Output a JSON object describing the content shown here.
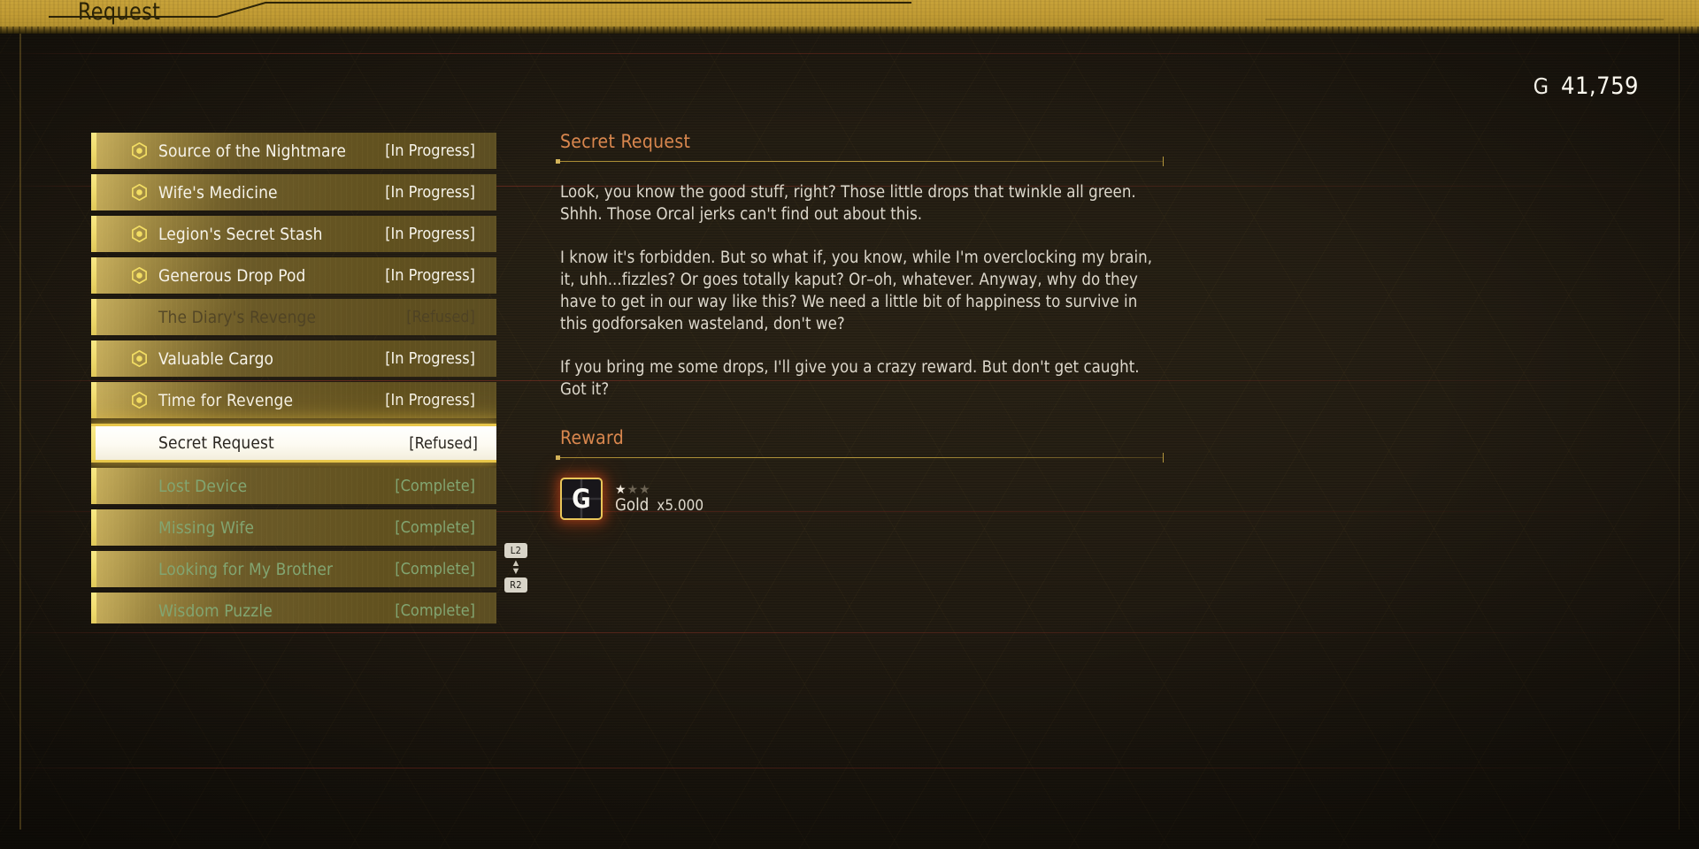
{
  "header": {
    "title": "Request"
  },
  "currency": {
    "symbol": "G",
    "amount": "41,759"
  },
  "quest_list": {
    "items": [
      {
        "name": "Source of the Nightmare",
        "status": "[In Progress]",
        "state": "in-progress"
      },
      {
        "name": "Wife's Medicine",
        "status": "[In Progress]",
        "state": "in-progress"
      },
      {
        "name": "Legion's Secret Stash",
        "status": "[In Progress]",
        "state": "in-progress"
      },
      {
        "name": "Generous Drop Pod",
        "status": "[In Progress]",
        "state": "in-progress"
      },
      {
        "name": "The Diary's Revenge",
        "status": "[Refused]",
        "state": "refused"
      },
      {
        "name": "Valuable Cargo",
        "status": "[In Progress]",
        "state": "in-progress"
      },
      {
        "name": "Time for Revenge",
        "status": "[In Progress]",
        "state": "in-progress"
      },
      {
        "name": "Secret Request",
        "status": "[Refused]",
        "state": "selected"
      },
      {
        "name": "Lost Device",
        "status": "[Complete]",
        "state": "complete"
      },
      {
        "name": "Missing Wife",
        "status": "[Complete]",
        "state": "complete"
      },
      {
        "name": "Looking for My Brother",
        "status": "[Complete]",
        "state": "complete"
      },
      {
        "name": "Wisdom Puzzle",
        "status": "[Complete]",
        "state": "complete"
      }
    ]
  },
  "scroll_hint": {
    "top_button": "L2",
    "bottom_button": "R2",
    "arrows": "▲▼"
  },
  "detail": {
    "title": "Secret Request",
    "paragraphs": [
      "Look, you know the good stuff, right? Those little drops that twinkle all green. Shhh. Those Orcal jerks can't find out about this.",
      "I know it's forbidden. But so what if, you know, while I'm overclocking my brain, it, uhh...fizzles? Or goes totally kaput? Or–oh, whatever. Anyway, why do they have to get in our way like this? We need a little bit of happiness to survive in this godforsaken wasteland, don't we?",
      "If you bring me some drops, I'll give you a crazy reward. But don't get caught. Got it?"
    ],
    "reward_header": "Reward",
    "reward": {
      "icon_letter": "G",
      "icon_name": "gold-coin-icon",
      "stars_filled": 1,
      "stars_total": 3,
      "name": "Gold",
      "quantity": "x5.000"
    }
  },
  "colors": {
    "header_gold": "#c29c34",
    "row_gold": "#6b5a28",
    "accent_orange": "#d9874e",
    "complete_green": "#82a571",
    "selected_bg": "#fdfbf2",
    "text_light": "#ddd8cc"
  }
}
